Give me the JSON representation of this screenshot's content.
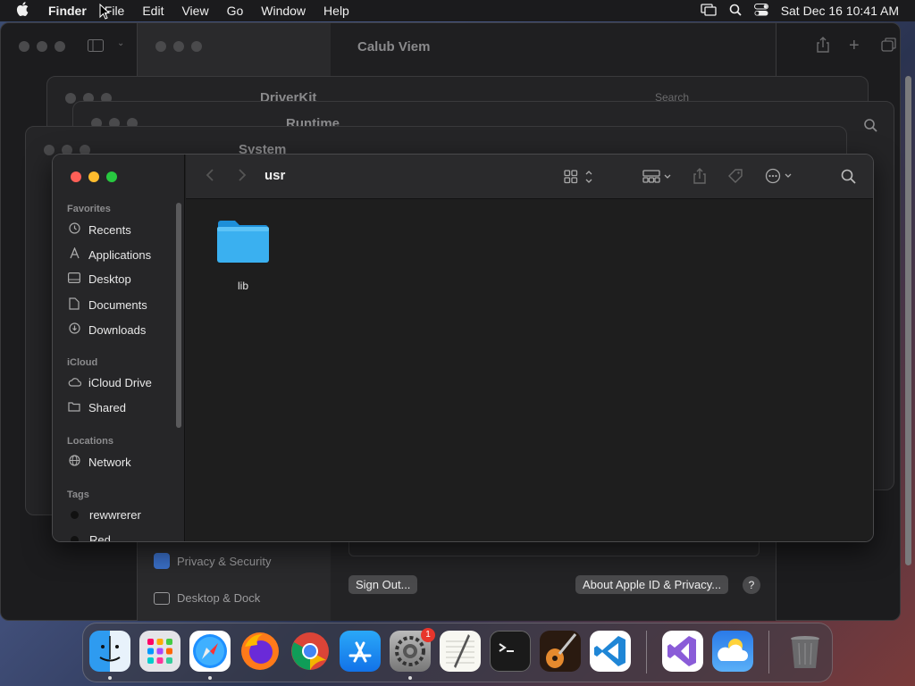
{
  "menubar": {
    "apple": "",
    "app": "Finder",
    "items": [
      "File",
      "Edit",
      "View",
      "Go",
      "Window",
      "Help"
    ],
    "datetime": "Sat Dec 16  10:41 AM"
  },
  "bg_windows": {
    "calib": "Calub Viem",
    "driverkit": "DriverKit",
    "runtime": "Runtime",
    "system": "System",
    "search_placeholder": "Search"
  },
  "finder": {
    "title": "usr",
    "sections": {
      "favorites": "Favorites",
      "icloud": "iCloud",
      "locations": "Locations",
      "tags": "Tags"
    },
    "favorites": [
      "Recents",
      "Applications",
      "Desktop",
      "Documents",
      "Downloads"
    ],
    "icloud": [
      "iCloud Drive",
      "Shared"
    ],
    "locations": [
      "Network"
    ],
    "tags": [
      "rewwrerer",
      "Red"
    ],
    "tag_colors": [
      "#111111",
      "#e0443e"
    ],
    "files": [
      {
        "name": "lib",
        "kind": "folder"
      }
    ]
  },
  "settings": {
    "privacy": "Privacy & Security",
    "desktop_dock": "Desktop & Dock",
    "sign_out": "Sign Out...",
    "about": "About Apple ID & Privacy...",
    "help": "?"
  },
  "dock": {
    "badge": "1",
    "apps": [
      "finder",
      "launchpad",
      "safari",
      "firefox",
      "chrome",
      "app-store",
      "system-settings",
      "textedit",
      "terminal",
      "garageband",
      "vscode",
      "visual-studio",
      "weather",
      "trash"
    ]
  }
}
